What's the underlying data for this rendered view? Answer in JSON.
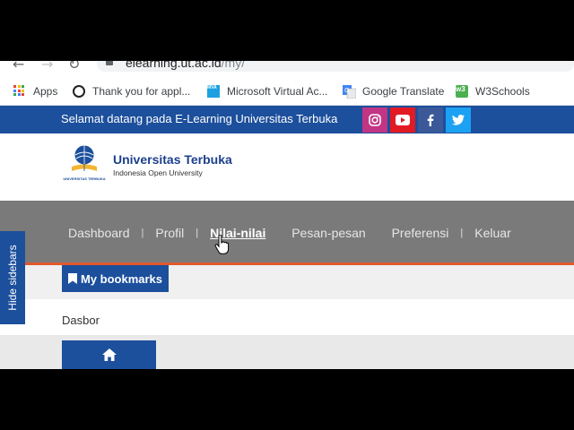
{
  "browser": {
    "url_host": "elearning.ut.ac.id",
    "url_path": "/my/",
    "bookmarks": [
      {
        "label": "Apps",
        "icon": "apps-grid-icon"
      },
      {
        "label": "Thank you for appl...",
        "icon": "ring-icon"
      },
      {
        "label": "Microsoft Virtual Ac...",
        "icon": "mva-icon"
      },
      {
        "label": "Google Translate",
        "icon": "google-translate-icon"
      },
      {
        "label": "W3Schools",
        "icon": "w3schools-icon"
      }
    ]
  },
  "site": {
    "welcome": "Selamat datang pada E-Learning Universitas Terbuka",
    "social": [
      "instagram-icon",
      "youtube-icon",
      "facebook-icon",
      "twitter-icon"
    ],
    "logo_title": "Universitas Terbuka",
    "logo_subtitle": "Indonesia Open University",
    "logo_small_text": "UNIVERSITAS TERBUKA"
  },
  "nav": {
    "items": [
      "Dashboard",
      "Profil",
      "Nilai-nilai",
      "Pesan-pesan",
      "Preferensi",
      "Keluar"
    ],
    "separator": "|"
  },
  "bookmarks_button": "My bookmarks",
  "breadcrumb": "Dasbor",
  "side_tab": "Hide sidebars",
  "colors": {
    "brand_blue": "#1c4f9c",
    "nav_gray": "#7a7a7a",
    "accent_orange": "#e0582d"
  }
}
